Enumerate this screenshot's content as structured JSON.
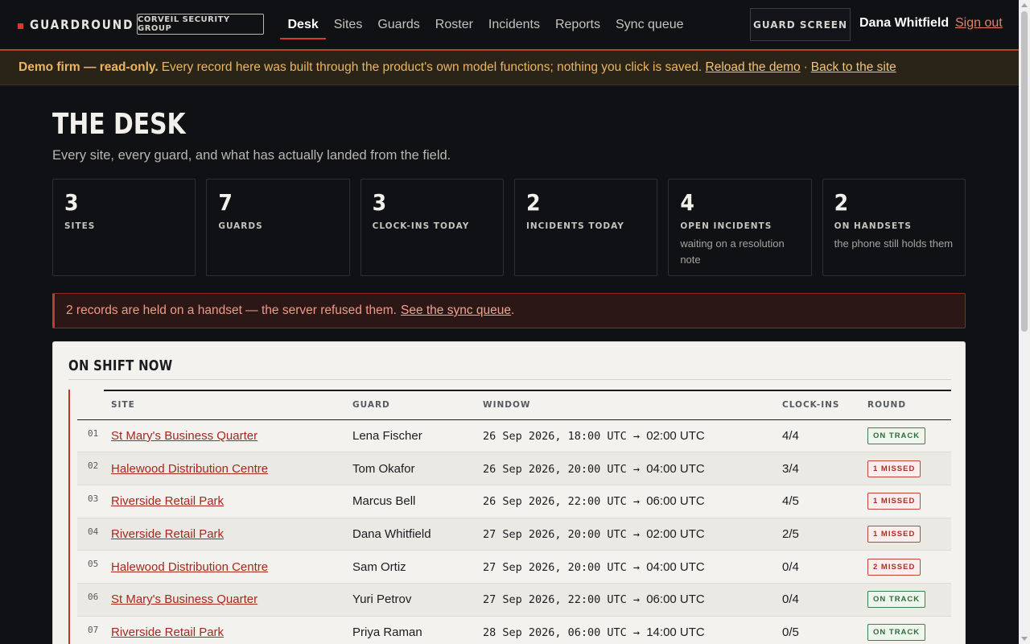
{
  "brand": {
    "name": "GUARDROUND",
    "org": "CORVEIL SECURITY GROUP"
  },
  "nav": [
    {
      "label": "Desk",
      "active": true
    },
    {
      "label": "Sites"
    },
    {
      "label": "Guards"
    },
    {
      "label": "Roster"
    },
    {
      "label": "Incidents"
    },
    {
      "label": "Reports"
    },
    {
      "label": "Sync queue"
    }
  ],
  "header": {
    "guard_screen": "GUARD SCREEN",
    "user_name": "Dana Whitfield",
    "sign_out": "Sign out"
  },
  "banner": {
    "bold": "Demo firm — read-only.",
    "text": "Every record here was built through the product's own model functions; nothing you click is saved.",
    "reload_link": "Reload the demo",
    "sep": "·",
    "back_link": "Back to the site"
  },
  "page": {
    "title": "THE DESK",
    "subtitle": "Every site, every guard, and what has actually landed from the field."
  },
  "stats": [
    {
      "value": "3",
      "label": "SITES",
      "note": ""
    },
    {
      "value": "7",
      "label": "GUARDS",
      "note": ""
    },
    {
      "value": "3",
      "label": "CLOCK-INS TODAY",
      "note": ""
    },
    {
      "value": "2",
      "label": "INCIDENTS TODAY",
      "note": ""
    },
    {
      "value": "4",
      "label": "OPEN INCIDENTS",
      "note": "waiting on a resolution note"
    },
    {
      "value": "2",
      "label": "ON HANDSETS",
      "note": "the phone still holds them"
    }
  ],
  "alert": {
    "text": "2 records are held on a handset — the server refused them.",
    "link": "See the sync queue",
    "tail": "."
  },
  "on_shift": {
    "title": "ON SHIFT NOW",
    "columns": [
      "SITE",
      "GUARD",
      "WINDOW",
      "CLOCK-INS",
      "ROUND"
    ],
    "rows": [
      {
        "idx": "01",
        "site": "St Mary's Business Quarter",
        "guard": "Lena Fischer",
        "window_start": "26 Sep 2026, 18:00 UTC →",
        "window_end": "02:00 UTC",
        "clockins": "4/4",
        "round": "ON TRACK",
        "status": "ok"
      },
      {
        "idx": "02",
        "site": "Halewood Distribution Centre",
        "guard": "Tom Okafor",
        "window_start": "26 Sep 2026, 20:00 UTC →",
        "window_end": "04:00 UTC",
        "clockins": "3/4",
        "round": "1 MISSED",
        "status": "miss"
      },
      {
        "idx": "03",
        "site": "Riverside Retail Park",
        "guard": "Marcus Bell",
        "window_start": "26 Sep 2026, 22:00 UTC →",
        "window_end": "06:00 UTC",
        "clockins": "4/5",
        "round": "1 MISSED",
        "status": "miss"
      },
      {
        "idx": "04",
        "site": "Riverside Retail Park",
        "guard": "Dana Whitfield",
        "window_start": "27 Sep 2026, 20:00 UTC →",
        "window_end": "02:00 UTC",
        "clockins": "2/5",
        "round": "1 MISSED",
        "status": "miss"
      },
      {
        "idx": "05",
        "site": "Halewood Distribution Centre",
        "guard": "Sam Ortiz",
        "window_start": "27 Sep 2026, 20:00 UTC →",
        "window_end": "04:00 UTC",
        "clockins": "0/4",
        "round": "2 MISSED",
        "status": "miss"
      },
      {
        "idx": "06",
        "site": "St Mary's Business Quarter",
        "guard": "Yuri Petrov",
        "window_start": "27 Sep 2026, 22:00 UTC →",
        "window_end": "06:00 UTC",
        "clockins": "0/4",
        "round": "ON TRACK",
        "status": "ok"
      },
      {
        "idx": "07",
        "site": "Riverside Retail Park",
        "guard": "Priya Raman",
        "window_start": "28 Sep 2026, 06:00 UTC →",
        "window_end": "14:00 UTC",
        "clockins": "0/5",
        "round": "ON TRACK",
        "status": "ok"
      }
    ]
  },
  "colors": {
    "accent": "#d63a2f",
    "ok": "#2f6b3e",
    "miss": "#b02a24",
    "link": "#a5281f"
  }
}
